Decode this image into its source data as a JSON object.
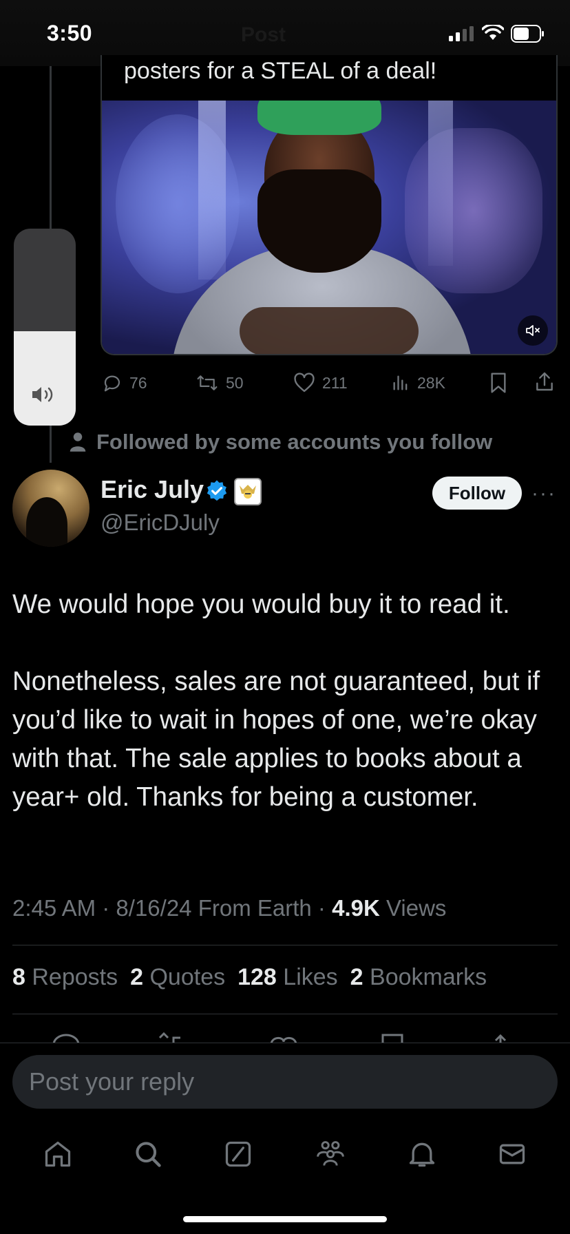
{
  "status_bar": {
    "time": "3:50"
  },
  "header": {
    "title": "Post"
  },
  "quoted_post": {
    "text_tail": "posters for a STEAL of a deal!",
    "video": {
      "muted": true
    },
    "actions": {
      "replies": "76",
      "reposts": "50",
      "likes": "211",
      "views": "28K"
    }
  },
  "volume_hud": {
    "level": 0.48
  },
  "social_context": "Followed by some accounts you follow",
  "author": {
    "name": "Eric July",
    "handle": "@EricDJuly",
    "verified": true,
    "follow_label": "Follow",
    "more_label": "···"
  },
  "post": {
    "paragraph_1": "We would hope you would buy it to read it.",
    "paragraph_2": "Nonetheless, sales are not guaranteed, but if you’d like to wait in hopes of one, we’re okay with that. The sale applies to books about a year+ old. Thanks for being a customer."
  },
  "meta": {
    "time": "2:45 AM",
    "sep1": "·",
    "date": "8/16/24",
    "location": "From Earth",
    "sep2": "·",
    "views_count": "4.9K",
    "views_label": "Views"
  },
  "stats": {
    "reposts_count": "8",
    "reposts_label": "Reposts",
    "quotes_count": "2",
    "quotes_label": "Quotes",
    "likes_count": "128",
    "likes_label": "Likes",
    "bookmarks_count": "2",
    "bookmarks_label": "Bookmarks"
  },
  "composer": {
    "placeholder": "Post your reply"
  },
  "tabbar": [
    "home-icon",
    "search-icon",
    "grok-icon",
    "communities-icon",
    "notifications-icon",
    "messages-icon"
  ],
  "colors": {
    "background": "#000000",
    "text": "#e7e9ea",
    "muted": "#71767b",
    "verified": "#1d9bf0",
    "divider": "#2f3336"
  }
}
